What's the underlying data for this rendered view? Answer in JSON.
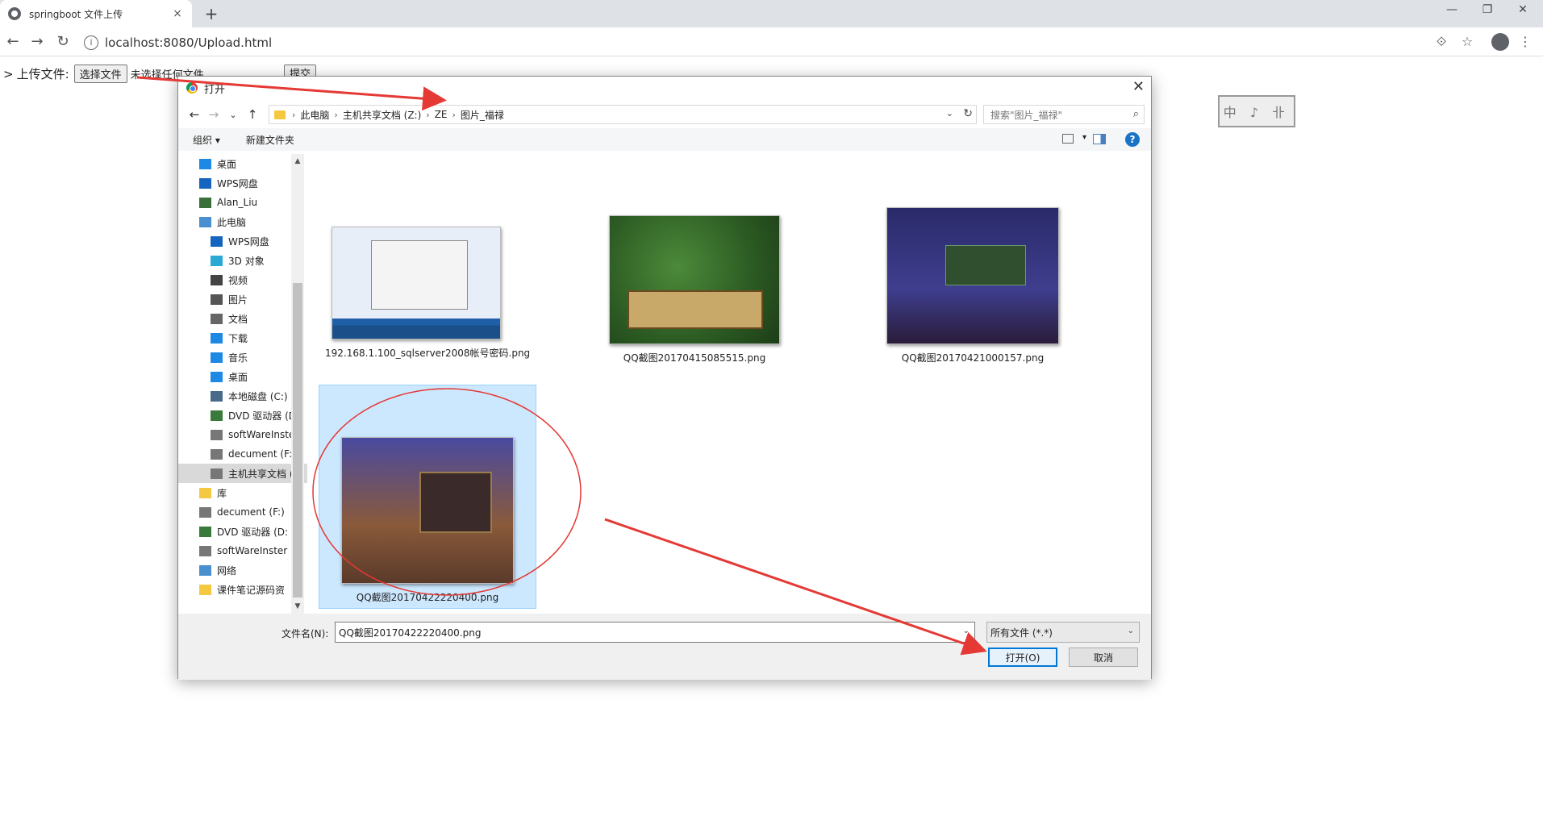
{
  "browser": {
    "tab_title": "springboot 文件上传",
    "tab_close": "×",
    "new_tab": "+",
    "win_minimize": "—",
    "win_restore": "❐",
    "win_close": "✕",
    "back": "←",
    "forward": "→",
    "reload": "↻",
    "info": "i",
    "url": "localhost:8080/Upload.html",
    "translate": "⟐",
    "star": "☆",
    "menu": "⋮"
  },
  "page": {
    "prefix": ">",
    "label": "上传文件:",
    "choose_button": "选择文件",
    "no_file": "未选择任何文件",
    "submit_button": "提交",
    "stamp_text": "中 ♪ 卝"
  },
  "dialog": {
    "title": "打开",
    "close": "✕",
    "nav_back": "←",
    "nav_forward": "→",
    "nav_recent": "⌄",
    "nav_up": "↑",
    "breadcrumbs": [
      "此电脑",
      "主机共享文档 (Z:)",
      "ZE",
      "图片_福禄"
    ],
    "crumb_sep": "›",
    "dropdown": "⌄",
    "refresh": "↻",
    "search_placeholder": "搜索\"图片_福禄\"",
    "search_icon": "⌕",
    "organize": "组织 ▾",
    "new_folder": "新建文件夹",
    "view_dropdown": "▾",
    "help": "?",
    "nav_items": [
      {
        "label": "桌面",
        "icon": "desktop-icon"
      },
      {
        "label": "WPS网盘",
        "icon": "cloud-icon"
      },
      {
        "label": "Alan_Liu",
        "icon": "user-icon"
      },
      {
        "label": "此电脑",
        "icon": "computer-icon"
      },
      {
        "label": "WPS网盘",
        "icon": "cloud-icon"
      },
      {
        "label": "3D 对象",
        "icon": "cube-icon"
      },
      {
        "label": "视频",
        "icon": "video-icon"
      },
      {
        "label": "图片",
        "icon": "pictures-icon"
      },
      {
        "label": "文档",
        "icon": "documents-icon"
      },
      {
        "label": "下载",
        "icon": "download-icon"
      },
      {
        "label": "音乐",
        "icon": "music-icon"
      },
      {
        "label": "桌面",
        "icon": "desktop-icon"
      },
      {
        "label": "本地磁盘 (C:)",
        "icon": "disk-icon"
      },
      {
        "label": "DVD 驱动器 (D:",
        "icon": "dvd-icon"
      },
      {
        "label": "softWareInste",
        "icon": "drive-icon"
      },
      {
        "label": "decument (F:)",
        "icon": "drive-icon"
      },
      {
        "label": "主机共享文档 (",
        "icon": "drive-icon"
      },
      {
        "label": "库",
        "icon": "library-icon"
      },
      {
        "label": "decument (F:)",
        "icon": "drive-icon"
      },
      {
        "label": "DVD 驱动器 (D:",
        "icon": "dvd-icon"
      },
      {
        "label": "softWareInster",
        "icon": "drive-icon"
      },
      {
        "label": "网络",
        "icon": "network-icon"
      },
      {
        "label": "课件笔记源码资",
        "icon": "folder-icon"
      }
    ],
    "files": [
      {
        "name": "192.168.1.100_sqlserver2008帐号密码.png"
      },
      {
        "name": "QQ截图20170415085515.png"
      },
      {
        "name": "QQ截图20170421000157.png"
      },
      {
        "name": "QQ截图20170422220400.png"
      }
    ],
    "filename_label": "文件名(N):",
    "filename_value": "QQ截图20170422220400.png",
    "filetype_value": "所有文件 (*.*)",
    "open_button": "打开(O)",
    "cancel_button": "取消"
  },
  "colors": {
    "annotation": "#e53935",
    "selection": "#cce8ff",
    "accent": "#0078d7"
  }
}
